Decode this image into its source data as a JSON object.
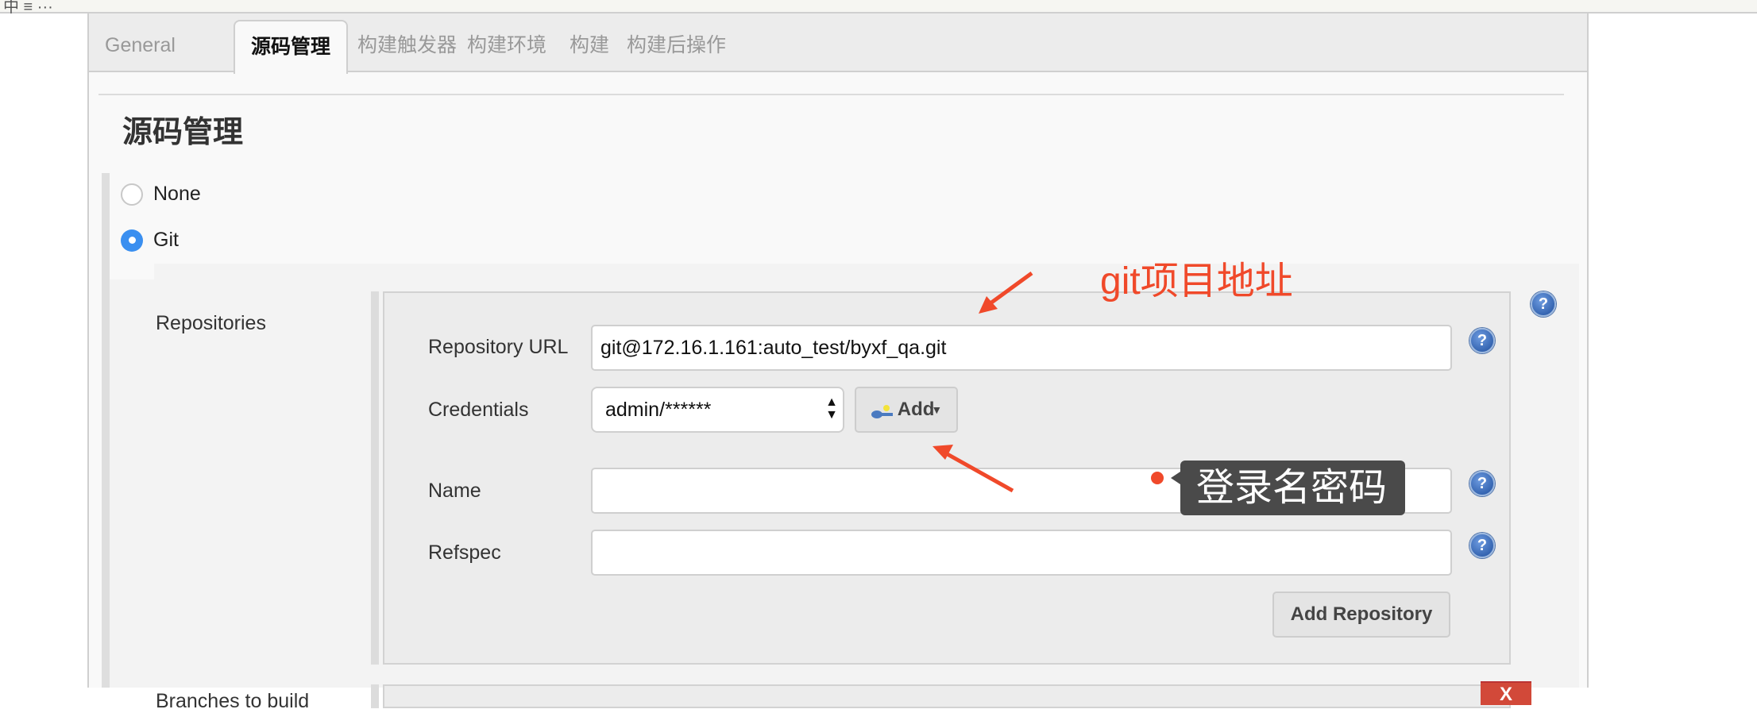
{
  "topbar": {
    "crumb": "中 ≡ ··· "
  },
  "tabs": [
    {
      "label": "General",
      "active": false
    },
    {
      "label": "源码管理",
      "active": true
    },
    {
      "label": "构建触发器",
      "active": false
    },
    {
      "label": "构建环境",
      "active": false
    },
    {
      "label": "构建",
      "active": false
    },
    {
      "label": "构建后操作",
      "active": false
    }
  ],
  "section": {
    "title": "源码管理"
  },
  "scm_options": [
    {
      "label": "None",
      "checked": false
    },
    {
      "label": "Git",
      "checked": true
    }
  ],
  "repositories": {
    "label": "Repositories",
    "url_label": "Repository URL",
    "url_value": "git@172.16.1.161:auto_test/byxf_qa.git",
    "credentials_label": "Credentials",
    "credentials_value": "admin/******",
    "add_button": "Add",
    "name_label": "Name",
    "name_value": "",
    "refspec_label": "Refspec",
    "refspec_value": "",
    "add_repository_button": "Add Repository"
  },
  "branches": {
    "label": "Branches to build",
    "delete_button": "X"
  },
  "annotations": {
    "git_url_note": "git项目地址",
    "credentials_note": "登录名密码",
    "color": "#f0492a"
  },
  "help_icon": "?"
}
